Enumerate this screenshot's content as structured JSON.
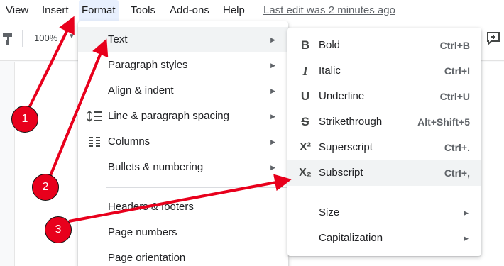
{
  "menubar": {
    "items": [
      "View",
      "Insert",
      "Format",
      "Tools",
      "Add-ons",
      "Help"
    ],
    "last_edit": "Last edit was 2 minutes ago"
  },
  "toolbar": {
    "zoom": "100%",
    "icons": [
      "paint-format-icon",
      "add-comment-icon"
    ]
  },
  "format_menu": {
    "items": [
      {
        "label": "Text",
        "has_submenu": true
      },
      {
        "label": "Paragraph styles",
        "has_submenu": true
      },
      {
        "label": "Align & indent",
        "has_submenu": true
      },
      {
        "label": "Line & paragraph spacing",
        "has_submenu": true,
        "icon": "line-spacing-icon"
      },
      {
        "label": "Columns",
        "has_submenu": true,
        "icon": "columns-icon"
      },
      {
        "label": "Bullets & numbering",
        "has_submenu": true
      },
      {
        "label": "Headers & footers"
      },
      {
        "label": "Page numbers"
      },
      {
        "label": "Page orientation"
      }
    ]
  },
  "text_submenu": {
    "items": [
      {
        "label": "Bold",
        "shortcut": "Ctrl+B",
        "icon": "bold-icon"
      },
      {
        "label": "Italic",
        "shortcut": "Ctrl+I",
        "icon": "italic-icon"
      },
      {
        "label": "Underline",
        "shortcut": "Ctrl+U",
        "icon": "underline-icon"
      },
      {
        "label": "Strikethrough",
        "shortcut": "Alt+Shift+5",
        "icon": "strikethrough-icon"
      },
      {
        "label": "Superscript",
        "shortcut": "Ctrl+.",
        "icon": "superscript-icon"
      },
      {
        "label": "Subscript",
        "shortcut": "Ctrl+,",
        "icon": "subscript-icon"
      },
      {
        "label": "Size",
        "has_submenu": true
      },
      {
        "label": "Capitalization",
        "has_submenu": true
      }
    ]
  },
  "annotations": {
    "badges": [
      "1",
      "2",
      "3"
    ],
    "color": "#e8001c"
  }
}
